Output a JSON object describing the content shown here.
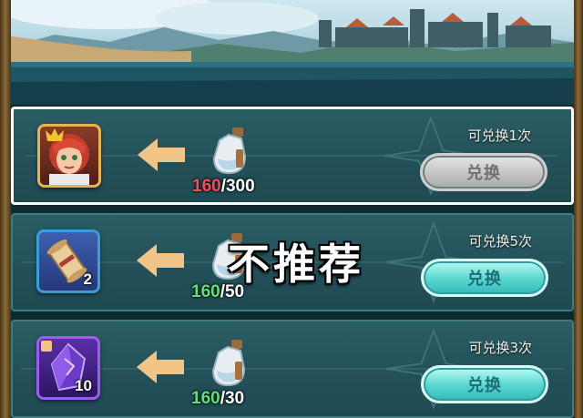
{
  "rows": [
    {
      "remaining": "可兑换1次",
      "have": "160",
      "need": "/300",
      "exchange_label": "兑换",
      "reward_icon": "hero-portrait-icon",
      "reward_count": "",
      "cost_icon": "potion-bottle-icon",
      "button_state": "disabled",
      "selected": true
    },
    {
      "remaining": "可兑换5次",
      "have": "160",
      "need": "/50",
      "exchange_label": "兑换",
      "reward_icon": "scroll-icon",
      "reward_count": "2",
      "cost_icon": "potion-bottle-icon",
      "button_state": "enabled",
      "selected": false
    },
    {
      "remaining": "可兑换3次",
      "have": "160",
      "need": "/30",
      "exchange_label": "兑换",
      "reward_icon": "crystal-shard-icon",
      "reward_count": "10",
      "cost_icon": "potion-bottle-icon",
      "button_state": "enabled",
      "selected": false
    }
  ],
  "overlay_text": "不推荐",
  "colors": {
    "insufficient": "#ff4a5a",
    "sufficient": "#5fe07a",
    "button_active": "#57d6cf",
    "button_disabled": "#a9a9a9",
    "highlight_border": "#ffffff"
  }
}
